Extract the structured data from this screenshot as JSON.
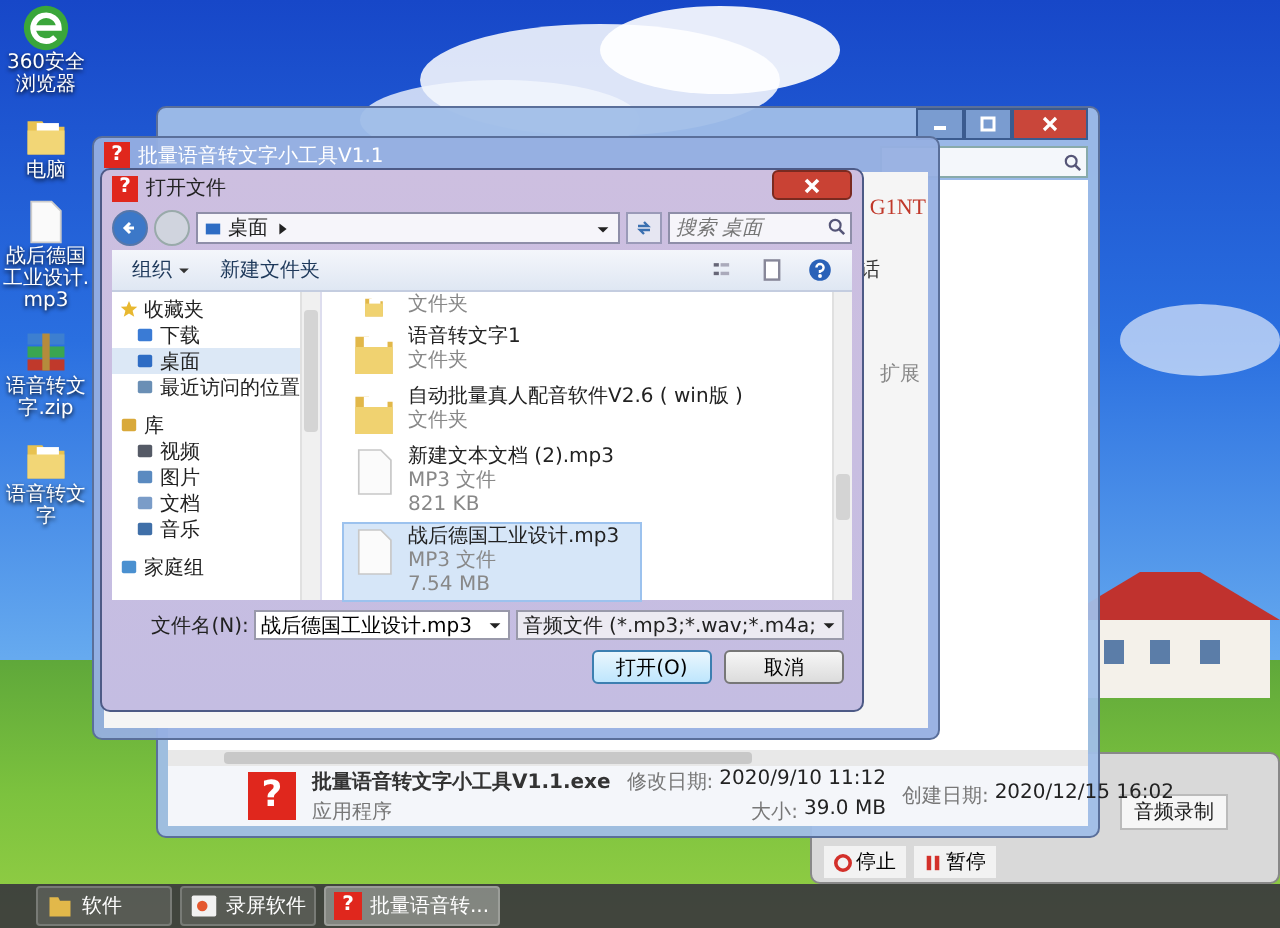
{
  "desktop_icons": [
    {
      "kind": "browser",
      "label": "360安全浏览器"
    },
    {
      "kind": "folder",
      "label": "电脑"
    },
    {
      "kind": "file",
      "label": "战后德国工业设计.mp3"
    },
    {
      "kind": "archive",
      "label": "语音转文字.zip"
    },
    {
      "kind": "folder",
      "label": "语音转文字"
    }
  ],
  "recorder_window": {
    "tabs": [
      {
        "label": "音频录制",
        "selected": true
      }
    ],
    "buttons": [
      {
        "kind": "stop",
        "label": "停止"
      },
      {
        "kind": "pause",
        "label": "暂停"
      }
    ]
  },
  "explorer_window": {
    "details": {
      "icon_glyph": "?",
      "name": "批量语音转文字小工具V1.1.exe",
      "type": "应用程序",
      "modified_label": "修改日期:",
      "modified": "2020/9/10 11:12",
      "size_label": "大小:",
      "size": "39.0 MB",
      "created_label": "创建日期:",
      "created": "2020/12/15 16:02"
    }
  },
  "app_window": {
    "icon_glyph": "?",
    "title": "批量语音转文字小工具V1.1",
    "brand": "G1NT",
    "fragments": [
      "话",
      "扩展"
    ]
  },
  "open_dialog": {
    "icon_glyph": "?",
    "title": "打开文件",
    "address": "桌面",
    "search": {
      "placeholder": "搜索 桌面"
    },
    "toolbar": [
      {
        "kind": "menu",
        "label": "组织"
      },
      {
        "kind": "button",
        "label": "新建文件夹"
      }
    ],
    "nav": [
      {
        "label": "收藏夹",
        "kind": "star",
        "selected": false,
        "children": [
          {
            "label": "下载",
            "kind": "download",
            "selected": false
          },
          {
            "label": "桌面",
            "kind": "desktop",
            "selected": true
          },
          {
            "label": "最近访问的位置",
            "kind": "recent",
            "selected": false
          }
        ]
      },
      {
        "label": "库",
        "kind": "library",
        "selected": false,
        "children": [
          {
            "label": "视频",
            "kind": "video",
            "selected": false
          },
          {
            "label": "图片",
            "kind": "picture",
            "selected": false
          },
          {
            "label": "文档",
            "kind": "document",
            "selected": false
          },
          {
            "label": "音乐",
            "kind": "music",
            "selected": false
          }
        ]
      },
      {
        "label": "家庭组",
        "kind": "homegroup",
        "selected": false
      }
    ],
    "files": [
      {
        "kind": "folder",
        "type": "文件夹",
        "selected": false
      },
      {
        "kind": "folder",
        "name": "语音转文字1",
        "type": "文件夹",
        "selected": false
      },
      {
        "kind": "folder",
        "name": "自动批量真人配音软件V2.6 ( win版 )",
        "type": "文件夹",
        "selected": false
      },
      {
        "kind": "file",
        "name": "新建文本文档 (2).mp3",
        "type": "MP3 文件",
        "size": "821 KB",
        "selected": false
      },
      {
        "kind": "file",
        "name": "战后德国工业设计.mp3",
        "type": "MP3 文件",
        "size": "7.54 MB",
        "selected": true
      }
    ],
    "filename_label": "文件名(N):",
    "filename": "战后德国工业设计.mp3",
    "filter": "音频文件 (*.mp3;*.wav;*.m4a;",
    "buttons": [
      {
        "label": "打开(O)",
        "default": true
      },
      {
        "label": "取消",
        "default": false
      }
    ]
  },
  "taskbar": {
    "items": [
      {
        "kind": "folder",
        "label": "软件",
        "active": false
      },
      {
        "kind": "recorder",
        "label": "录屏软件",
        "active": false
      },
      {
        "kind": "app",
        "label": "批量语音转...",
        "glyph": "?",
        "active": true
      }
    ]
  }
}
